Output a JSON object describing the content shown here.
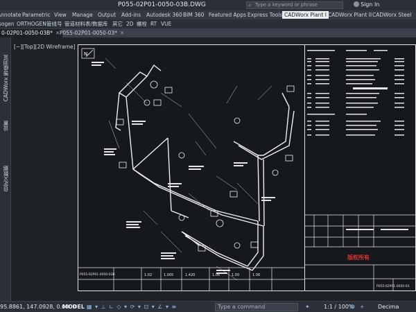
{
  "titlebar": {
    "title": "P055-02P01-0050-03B.DWG",
    "search_placeholder": "Type a keyword or phrase",
    "sign_in": "Sign In"
  },
  "ribbon": {
    "tabs": [
      {
        "label": "Annotate"
      },
      {
        "label": "Parametric"
      },
      {
        "label": "View"
      },
      {
        "label": "Manage"
      },
      {
        "label": "Output"
      },
      {
        "label": "Add-ins"
      },
      {
        "label": "Autodesk 360"
      },
      {
        "label": "BIM 360"
      },
      {
        "label": "Featured Apps"
      },
      {
        "label": "Express Tools"
      },
      {
        "label": "CADWorx Plant I"
      },
      {
        "label": "CADWorx Plant II"
      },
      {
        "label": "CADWorx Steel"
      }
    ],
    "active_index": 10
  },
  "toolbar": {
    "items": [
      "sogen",
      "ORTHOGEN",
      "管线号",
      "管道材料表/数据库",
      "其它",
      "2D",
      "螺栓",
      "RT",
      "VUE"
    ]
  },
  "doc_tabs": [
    {
      "label": "0-02P01-0050-03B*"
    },
    {
      "label": "P055-02P01-0050-03*"
    }
  ],
  "palette": {
    "labels": [
      "CADWorx 等级浏览",
      "设置",
      "自定义数据"
    ]
  },
  "viewport": {
    "label": "[−][Top][2D Wireframe]"
  },
  "drawing": {
    "title_block_number": "P055-02P01-0050-03B",
    "bottom_number": "P055-02P01-0050-03",
    "brand_text": "版权所有",
    "dims": [
      "1.02",
      "1.005",
      "1.420",
      "1.06",
      "1.00",
      "1.06"
    ]
  },
  "statusbar": {
    "coords": "95.8861, 147.0928, 0.0000",
    "model": "MODEL",
    "command_placeholder": "Type a command",
    "scale": "1:1 / 100%",
    "units": "Decima"
  }
}
